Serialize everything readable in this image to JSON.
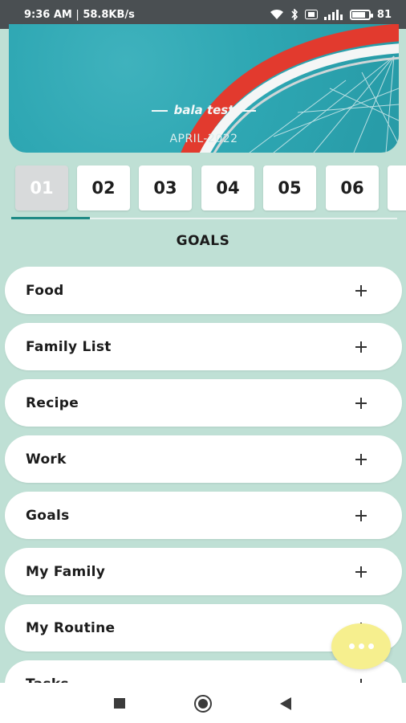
{
  "status_bar": {
    "time": "9:36 AM",
    "separator": "|",
    "network_speed": "58.8KB/s",
    "battery_percent": "81",
    "battery_level": 0.81,
    "icons": [
      "wifi-icon",
      "bluetooth-icon",
      "volte-icon",
      "signal-icon",
      "battery-icon"
    ]
  },
  "banner": {
    "title": "bala test",
    "date": "APRIL-2022"
  },
  "days": [
    "01",
    "02",
    "03",
    "04",
    "05",
    "06"
  ],
  "selected_day": "01",
  "section_heading": "GOALS",
  "list_items": [
    {
      "label": "Food",
      "action_icon": "plus-icon"
    },
    {
      "label": "Family List",
      "action_icon": "plus-icon"
    },
    {
      "label": "Recipe",
      "action_icon": "plus-icon"
    },
    {
      "label": "Work",
      "action_icon": "plus-icon"
    },
    {
      "label": "Goals",
      "action_icon": "plus-icon"
    },
    {
      "label": "My Family",
      "action_icon": "plus-icon"
    },
    {
      "label": "My Routine",
      "action_icon": "plus-icon"
    },
    {
      "label": "Tasks",
      "action_icon": "plus-icon"
    }
  ],
  "fab": {
    "icon": "more-dots-icon"
  },
  "nav_bar": {
    "icons": [
      "recents-icon",
      "home-icon",
      "back-icon"
    ]
  },
  "colors": {
    "background": "#bfe0d5",
    "accent": "#1f8a85",
    "fab": "#f6ef8e",
    "selected_tab": "#d8dadb"
  }
}
